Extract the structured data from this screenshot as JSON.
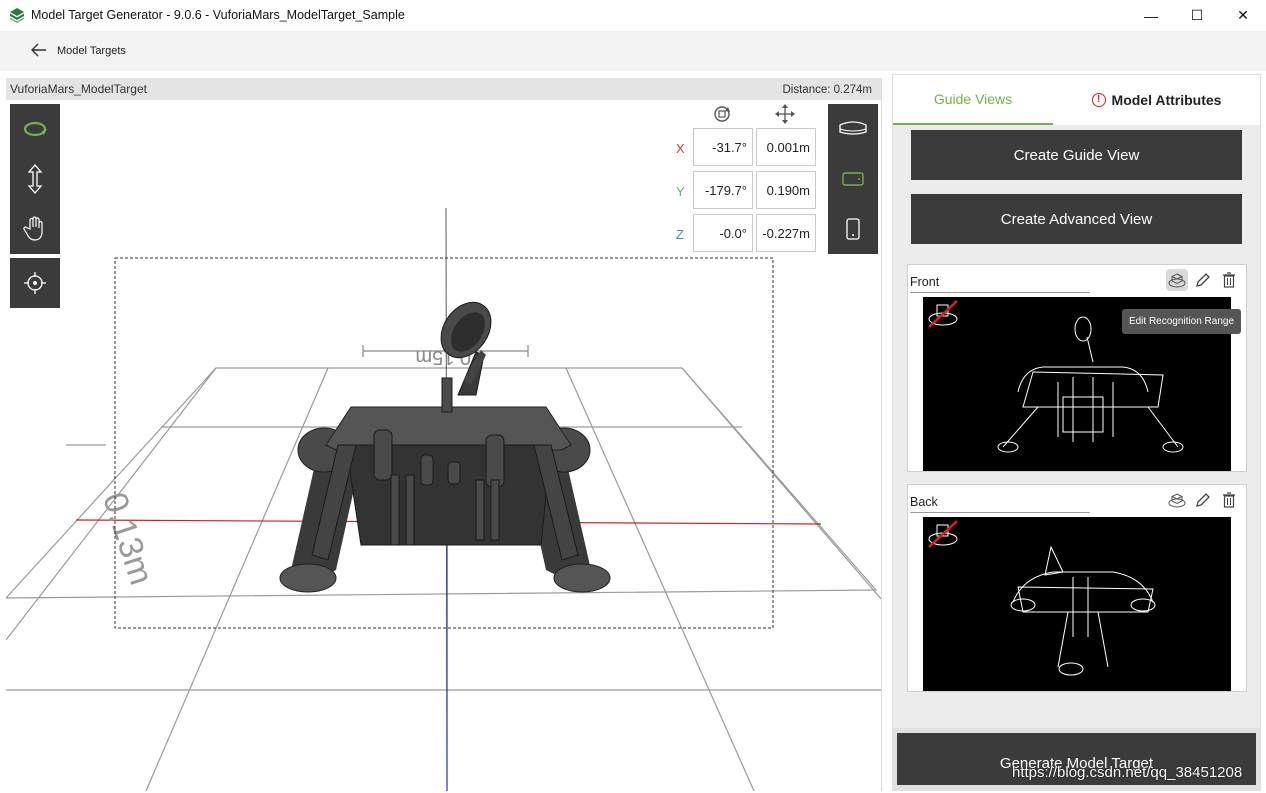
{
  "window": {
    "title": "Model Target Generator - 9.0.6 - VuforiaMars_ModelTarget_Sample",
    "minimize": "—",
    "maximize": "☐",
    "close": "✕"
  },
  "nav": {
    "back_icon": "back-arrow-icon",
    "label": "Model Targets"
  },
  "viewport": {
    "model_name": "VuforiaMars_ModelTarget",
    "distance": "Distance: 0.274m",
    "dim_label_1": "0.15m",
    "dim_label_2": "0.13m",
    "left_tools": [
      "orbit-icon",
      "pan-vertical-icon",
      "hand-icon"
    ],
    "center_tool": "crosshair-icon",
    "right_tools": [
      "headset-icon",
      "tablet-icon",
      "phone-icon"
    ],
    "rotate_icon": "rotate-icon",
    "move_icon": "move-icon",
    "coords": [
      {
        "axis": "X",
        "rotation": "-31.7°",
        "position": "0.001m",
        "color": "#d33b3b"
      },
      {
        "axis": "Y",
        "rotation": "-179.7°",
        "position": "0.190m",
        "color": "#5cb85c"
      },
      {
        "axis": "Z",
        "rotation": "-0.0°",
        "position": "-0.227m",
        "color": "#3a8fc8"
      }
    ],
    "accent_color": "#74b14a"
  },
  "sidebar": {
    "tabs": [
      {
        "label": "Guide Views",
        "active": true
      },
      {
        "label": "Model Attributes",
        "active": false,
        "warning": "!"
      }
    ],
    "create_guide_view": "Create Guide View",
    "create_advanced_view": "Create Advanced View",
    "guide_views": [
      {
        "name": "Front",
        "tooltip": "Edit Recognition Range"
      },
      {
        "name": "Back"
      }
    ],
    "generate": "Generate Model Target"
  },
  "watermark": "https://blog.csdn.net/qq_38451208"
}
